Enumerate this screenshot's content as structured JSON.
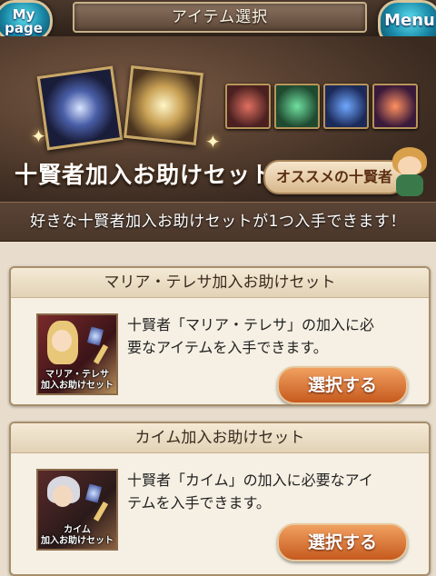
{
  "header": {
    "mypage_label": "My page",
    "title": "アイテム選択",
    "menu_label": "Menu"
  },
  "banner": {
    "title": "十賢者加入お助けセット",
    "recommend_label": "オススメの十賢者"
  },
  "subtitle": "好きな十賢者加入お助けセットが1つ入手できます！",
  "cards": [
    {
      "title": "マリア・テレサ加入お助けセット",
      "thumb_caption_line1": "マリア・テレサ",
      "thumb_caption_line2": "加入お助けセット",
      "desc_line1": "十賢者「マリア・テレサ」の加入に必",
      "desc_line2": "要なアイテムを入手できます。",
      "button": "選択する"
    },
    {
      "title": "カイム加入お助けセット",
      "thumb_caption_line1": "カイム",
      "thumb_caption_line2": "加入お助けセット",
      "desc_line1": "十賢者「カイム」の加入に必要なアイ",
      "desc_line2": "テムを入手できます。",
      "button": "選択する"
    }
  ],
  "colors": {
    "accent_button": "#d06a2a",
    "header_orb": "#2aa0c0"
  }
}
